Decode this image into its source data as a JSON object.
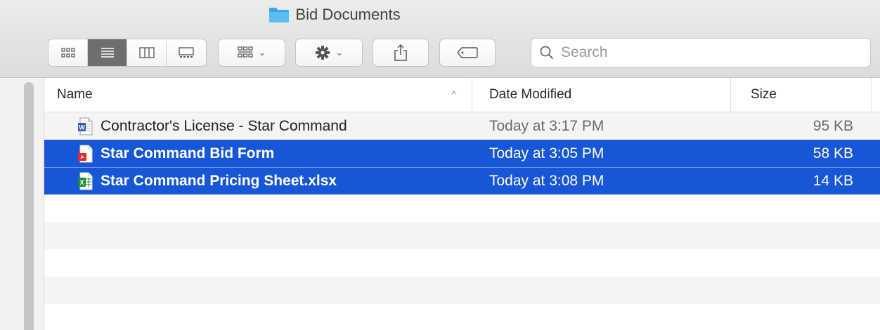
{
  "window": {
    "title": "Bid Documents",
    "title_icon": "folder-icon"
  },
  "toolbar": {
    "view_modes": [
      {
        "name": "icon-view",
        "icon": "grid-icon",
        "active": false
      },
      {
        "name": "list-view",
        "icon": "list-icon",
        "active": true
      },
      {
        "name": "column-view",
        "icon": "columns-icon",
        "active": false
      },
      {
        "name": "gallery-view",
        "icon": "gallery-icon",
        "active": false
      }
    ],
    "group_icon": "group-grid-icon",
    "action_icon": "gear-icon",
    "share_icon": "share-icon",
    "tag_icon": "tag-icon",
    "chevron": "⌄",
    "search_placeholder": "Search"
  },
  "columns": {
    "name": "Name",
    "date": "Date Modified",
    "size": "Size",
    "sort_indicator": "^"
  },
  "files": [
    {
      "name": "Contractor's License - Star Command",
      "date": "Today at 3:17 PM",
      "size": "95 KB",
      "type": "word",
      "selected": false
    },
    {
      "name": "Star Command Bid Form",
      "date": "Today at 3:05 PM",
      "size": "58 KB",
      "type": "pdf",
      "selected": true
    },
    {
      "name": "Star Command Pricing Sheet.xlsx",
      "date": "Today at 3:08 PM",
      "size": "14 KB",
      "type": "excel",
      "selected": true
    }
  ],
  "colors": {
    "selection": "#1756d6",
    "folder": "#3ba6e8",
    "word": "#2b5cb8",
    "pdf": "#e02c2c",
    "excel": "#1f8a3e"
  }
}
